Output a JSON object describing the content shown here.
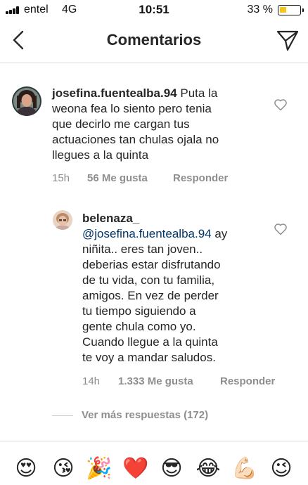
{
  "status_bar": {
    "carrier": "entel",
    "network": "4G",
    "time": "10:51",
    "battery_percent": "33 %",
    "battery_level": 0.33
  },
  "nav": {
    "title": "Comentarios",
    "back_icon": "chevron-left-icon",
    "share_icon": "paper-plane-icon"
  },
  "comments": [
    {
      "username": "josefina.fuentealba.94",
      "lines": [
        "Puta la",
        "weona fea lo siento pero tenia",
        "que decirlo me cargan tus",
        "actuaciones tan chulas ojala no",
        "llegues a la quinta"
      ],
      "time": "15h",
      "likes": "56 Me gusta",
      "reply_label": "Responder"
    },
    {
      "username": "belenaza_",
      "mention": "@josefina.fuentealba.94",
      "lines": [
        " ay",
        "niñita.. eres tan joven..",
        "deberias estar disfrutando",
        "de tu vida, con tu familia,",
        "amigos. En vez de perder",
        "tu tiempo siguiendo a",
        "gente chula como yo.",
        "Cuando llegue a la quinta",
        "te voy a mandar saludos."
      ],
      "time": "14h",
      "likes": "1.333 Me gusta",
      "reply_label": "Responder"
    }
  ],
  "more_replies": "Ver más respuestas (172)",
  "emoji_bar": [
    "😍",
    "😘",
    "🎉",
    "❤️",
    "😎",
    "😂",
    "💪🏻",
    "😉"
  ],
  "colors": {
    "text": "#262626",
    "muted": "#8e8e8e",
    "mention": "#003569",
    "divider": "#dbdbdb",
    "battery": "#f5c518"
  }
}
